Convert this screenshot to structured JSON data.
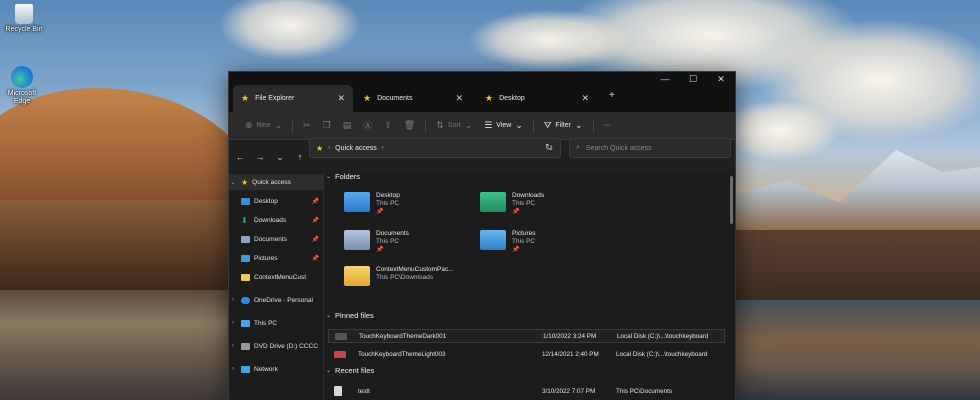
{
  "desktop": {
    "icons": [
      {
        "label": "Recycle Bin",
        "icon": "recycle-bin-icon"
      },
      {
        "label": "Microsoft Edge",
        "icon": "edge-icon"
      }
    ]
  },
  "window": {
    "tabs": [
      {
        "label": "File Explorer",
        "active": true
      },
      {
        "label": "Documents",
        "active": false
      },
      {
        "label": "Desktop",
        "active": false
      }
    ],
    "new_tab": "+",
    "controls": {
      "minimize": "—",
      "maximize": "☐",
      "close": "✕"
    }
  },
  "toolbar": {
    "new_label": "New",
    "sort_label": "Sort",
    "view_label": "View",
    "filter_label": "Filter",
    "more_label": "···"
  },
  "addressbar": {
    "path_label": "Quick access",
    "search_placeholder": "Search Quick access"
  },
  "sidebar": {
    "items": [
      {
        "label": "Quick access",
        "icon": "star-icon",
        "color": "#f5c518",
        "expand": "⌄",
        "pinned": false
      },
      {
        "label": "Desktop",
        "icon": "desktop-folder-icon",
        "color": "#3b8fd9",
        "expand": "",
        "pinned": true
      },
      {
        "label": "Downloads",
        "icon": "downloads-icon",
        "color": "#2fae7a",
        "expand": "",
        "pinned": true
      },
      {
        "label": "Documents",
        "icon": "documents-icon",
        "color": "#8ea4c4",
        "expand": "",
        "pinned": true
      },
      {
        "label": "Pictures",
        "icon": "pictures-icon",
        "color": "#3f9ad6",
        "expand": "",
        "pinned": true
      },
      {
        "label": "ContextMenuCust",
        "icon": "folder-icon",
        "color": "#f3c650",
        "expand": "",
        "pinned": false
      },
      {
        "label": "OneDrive - Personal",
        "icon": "onedrive-icon",
        "color": "#2d8de0",
        "expand": "›",
        "pinned": false
      },
      {
        "label": "This PC",
        "icon": "this-pc-icon",
        "color": "#4aa3e0",
        "expand": "›",
        "pinned": false
      },
      {
        "label": "DVD Drive (D:) CCCC",
        "icon": "dvd-drive-icon",
        "color": "#9a9a9a",
        "expand": "›",
        "pinned": false
      },
      {
        "label": "Network",
        "icon": "network-icon",
        "color": "#4aa3e0",
        "expand": "›",
        "pinned": false
      }
    ]
  },
  "content": {
    "folders_header": "Folders",
    "folders": [
      {
        "name": "Desktop",
        "location": "This PC",
        "color": "#3b8fd9"
      },
      {
        "name": "Downloads",
        "location": "This PC",
        "color": "#2fae7a"
      },
      {
        "name": "Documents",
        "location": "This PC",
        "color": "#8ea4c4"
      },
      {
        "name": "Pictures",
        "location": "This PC",
        "color": "#3f9ad6"
      },
      {
        "name": "ContextMenuCustomPac...",
        "location": "This PC\\Downloads",
        "color": "#f3c650"
      }
    ],
    "pinned_header": "Pinned files",
    "pinned_files": [
      {
        "name": "TouchKeyboardThemeDark001",
        "date": "1/10/2022 3:24 PM",
        "location": "Local Disk (C:)\\...\\touchkeyboard",
        "color": "#555555"
      },
      {
        "name": "TouchKeyboardThemeLight003",
        "date": "12/14/2021 2:40 PM",
        "location": "Local Disk (C:)\\...\\touchkeyboard",
        "color": "#c84545"
      }
    ],
    "recent_header": "Recent files",
    "recent_files": [
      {
        "name": "testt",
        "date": "3/10/2022 7:07 PM",
        "location": "This PC\\Documents",
        "color": "#d8d8d8"
      }
    ]
  }
}
